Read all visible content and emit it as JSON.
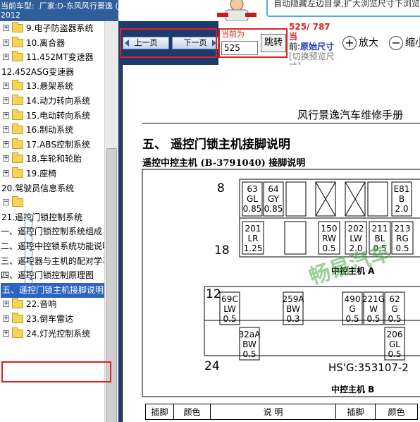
{
  "header": {
    "line1": "当前车型:  厂家:D-东风风行景逸 (Joyear)",
    "line2": "2012"
  },
  "banner": {
    "text": "自动隐藏左边目录,扩大浏览尺寸下浏览"
  },
  "tree": [
    {
      "type": "folder",
      "label": "9.电子防盗器系统"
    },
    {
      "type": "folder",
      "label": "10.离合器"
    },
    {
      "type": "folder",
      "label": "11.452MT变速器"
    },
    {
      "type": "text",
      "label": "12.452ASG变速器"
    },
    {
      "type": "folder",
      "label": "13.悬架系统"
    },
    {
      "type": "folder",
      "label": "14.动力转向系统"
    },
    {
      "type": "folder",
      "label": "15.电动转向系统"
    },
    {
      "type": "folder",
      "label": "16.制动系统"
    },
    {
      "type": "folder",
      "label": "17.ABS控制系统"
    },
    {
      "type": "folder",
      "label": "18.车轮和轮胎"
    },
    {
      "type": "folder",
      "label": "19.座椅"
    },
    {
      "type": "text",
      "label": "20.驾驶员信息系统"
    },
    {
      "type": "openfolder",
      "label": ""
    },
    {
      "type": "text",
      "label": "21.遥控门锁控制系统"
    },
    {
      "type": "doc",
      "label": "一、遥控门锁控制系统组成"
    },
    {
      "type": "doc",
      "label": "二、遥控中控锁系统功能说明"
    },
    {
      "type": "doc",
      "label": "三、遥控器与主机的配对学习"
    },
    {
      "type": "doc",
      "label": "四、遥控门锁控制原理图"
    },
    {
      "type": "doc",
      "label": "五、遥控门锁主机接脚说明",
      "selected": true
    },
    {
      "type": "folder",
      "label": "22.音响"
    },
    {
      "type": "folder",
      "label": "23.倒车雷达"
    },
    {
      "type": "folder",
      "label": "24.灯光控制系统"
    }
  ],
  "toolbar": {
    "prev_label": "上一页",
    "next_label": "下一页",
    "current_label": "当前为",
    "page_value": "525",
    "jump_label": "跳转",
    "page_count": "525/ 787 当",
    "page_now_prefix": "前:",
    "page_now_size": "原始尺寸",
    "switch_link": "[切换预览尺寸]",
    "zoom_in_label": "放大",
    "zoom_out_label": "缩小",
    "zoom_in_glyph": "+",
    "zoom_out_glyph": "−"
  },
  "document": {
    "manual_title": "风行景逸汽车维修手册",
    "section_heading": "五、 遥控门锁主机接脚说明",
    "sub_heading": "遥控中控主机 (B-3791040) 接脚说明",
    "connector_a": {
      "pin_top": "8",
      "pin_bottom": "18",
      "label": "中控主机    A",
      "top_cells": [
        {
          "lines": [
            "63",
            "GL",
            "0.85"
          ]
        },
        {
          "lines": [
            "64",
            "GY",
            "0.85"
          ]
        },
        {
          "lines": []
        },
        {
          "lines": []
        },
        {
          "lines": []
        },
        {
          "lines": []
        },
        {
          "lines": [
            "E81",
            "B",
            "2.0"
          ]
        }
      ],
      "bottom_cells": [
        {
          "lines": [
            "201",
            "LR",
            "1.25"
          ]
        },
        {
          "lines": []
        },
        {
          "lines": [
            "150",
            "RW",
            "0.5"
          ]
        },
        {
          "lines": [
            "202",
            "LW",
            "2.0"
          ]
        },
        {
          "lines": [
            "211",
            "BL",
            "0.5"
          ]
        },
        {
          "lines": [
            "213",
            "RG",
            "0.5"
          ]
        }
      ]
    },
    "connector_b": {
      "pin_top": "12",
      "pin_bottom": "24",
      "part_no": "HS'G:353107-2",
      "label": "中控主机    B",
      "cells": [
        {
          "lines": [
            "69C",
            "LW",
            "0.5"
          ]
        },
        {
          "lines": [
            "259A",
            "BW",
            "0.3"
          ]
        },
        {
          "lines": [
            "490",
            "G",
            "0.5"
          ]
        },
        {
          "lines": [
            "221G",
            "W",
            "0.5"
          ]
        },
        {
          "lines": [
            "62",
            "G",
            "0.5"
          ]
        },
        {
          "lines": [
            "32aA",
            "BW",
            "0.5"
          ]
        },
        {
          "lines": [
            "206",
            "GL",
            "0.5"
          ]
        }
      ]
    },
    "table_headers": [
      "插脚",
      "颜色",
      "说 明",
      "插脚",
      "颜色"
    ],
    "watermark": "畅易汽车"
  }
}
